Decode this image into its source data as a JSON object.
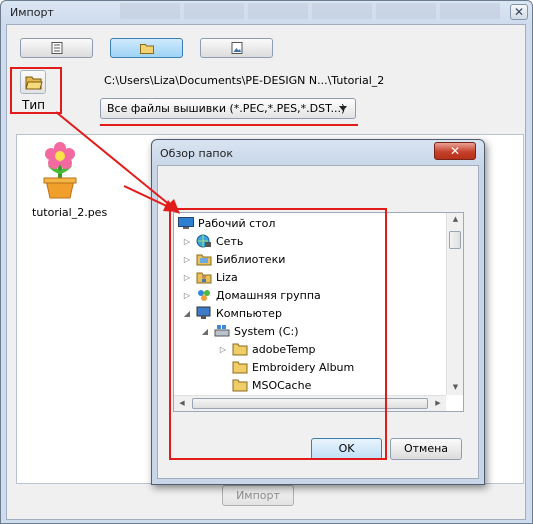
{
  "window": {
    "title": "Импорт",
    "close_glyph": "✕"
  },
  "toolbar": {
    "buttons": [
      {
        "icon": "list-view-icon"
      },
      {
        "icon": "folder-icon",
        "active": true
      },
      {
        "icon": "thumbnail-view-icon"
      }
    ]
  },
  "type_button": {
    "icon": "open-folder-icon",
    "label": "Тип"
  },
  "path": "C:\\Users\\Liza\\Documents\\PE-DESIGN N...\\Tutorial_2",
  "filter": {
    "selected": "Все файлы вышивки (*.PEC,*.PES,*.DST...)"
  },
  "files": [
    {
      "name": "tutorial_2.pes",
      "icon": "flower-icon"
    }
  ],
  "import_button": "Импорт",
  "dialog": {
    "title": "Обзор папок",
    "close_glyph": "✕",
    "tree": [
      {
        "label": "Рабочий стол",
        "icon": "desktop-icon",
        "expander": "",
        "level": 0
      },
      {
        "label": "Сеть",
        "icon": "network-icon",
        "expander": "▷",
        "level": 1
      },
      {
        "label": "Библиотеки",
        "icon": "libraries-icon",
        "expander": "▷",
        "level": 1
      },
      {
        "label": "Liza",
        "icon": "user-folder-icon",
        "expander": "▷",
        "level": 1
      },
      {
        "label": "Домашняя группа",
        "icon": "homegroup-icon",
        "expander": "▷",
        "level": 1
      },
      {
        "label": "Компьютер",
        "icon": "computer-icon",
        "expander": "◢",
        "level": 1
      },
      {
        "label": "System (C:)",
        "icon": "drive-icon",
        "expander": "◢",
        "level": 2
      },
      {
        "label": "adobeTemp",
        "icon": "folder-icon",
        "expander": "▷",
        "level": 3
      },
      {
        "label": "Embroidery Album",
        "icon": "folder-icon",
        "expander": "",
        "level": 3
      },
      {
        "label": "MSOCache",
        "icon": "folder-icon",
        "expander": "",
        "level": 3
      }
    ],
    "ok": "OK",
    "cancel": "Отмена"
  },
  "colors": {
    "annotation": "#e21b1b",
    "accent": "#3c7fb1"
  }
}
